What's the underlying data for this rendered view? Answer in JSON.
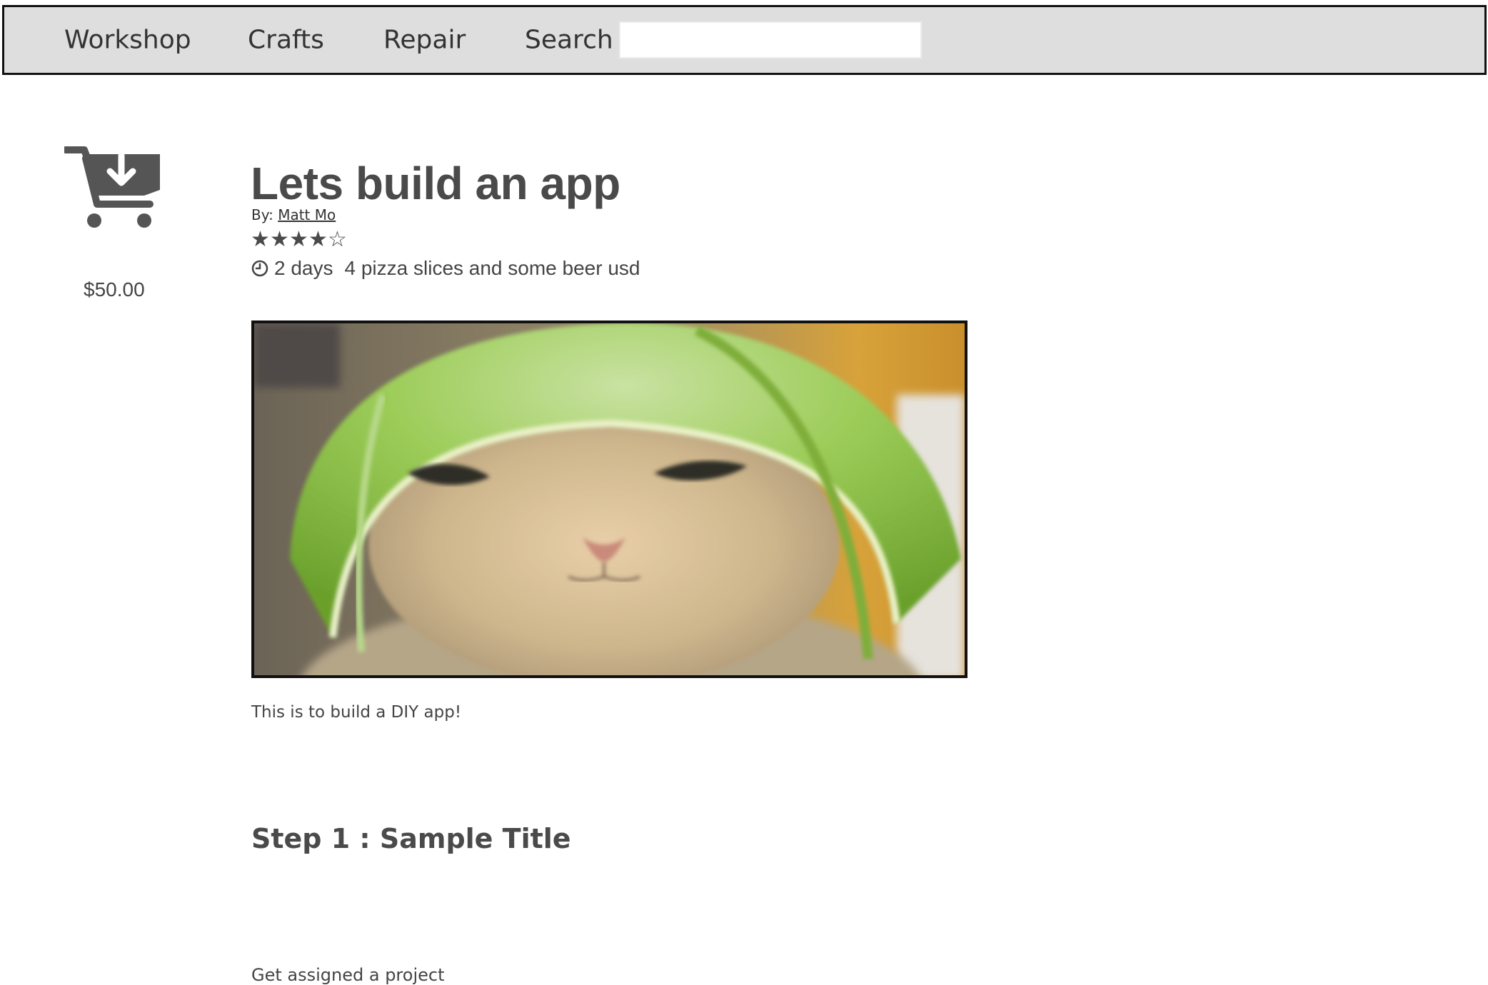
{
  "nav": {
    "items": [
      {
        "label": "Workshop"
      },
      {
        "label": "Crafts"
      },
      {
        "label": "Repair"
      }
    ],
    "search_label": "Search",
    "search_value": ""
  },
  "sidebar": {
    "cart_icon": "cart-download-icon",
    "price": "$50.00"
  },
  "project": {
    "title": "Lets build an app",
    "by_prefix": "By:",
    "author": "Matt Mo",
    "rating": {
      "value": 4,
      "max": 5
    },
    "stars": [
      "★",
      "★",
      "★",
      "★",
      "☆"
    ],
    "clock_icon": "clock-icon",
    "duration": "2 days",
    "cost": "4 pizza slices and some beer usd",
    "image_subject": "cat-wearing-lime-helmet-photo",
    "description": "This is to build a DIY app!"
  },
  "steps": [
    {
      "title": "Step 1 : Sample Title",
      "body": "Get assigned a project"
    }
  ],
  "colors": {
    "nav_bg": "#dedede",
    "nav_border": "#111111",
    "text": "#4a4a4a",
    "icon": "#555555"
  }
}
